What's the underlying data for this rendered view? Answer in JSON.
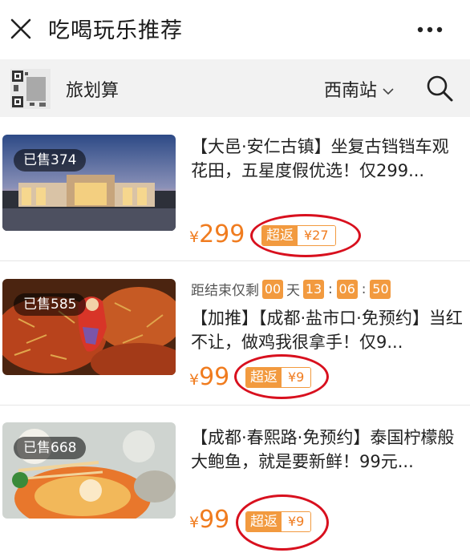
{
  "header": {
    "title": "吃喝玩乐推荐",
    "close_icon": "close-icon",
    "more_icon": "more-dots-icon"
  },
  "shop": {
    "name": "旅划算",
    "city": "西南站",
    "search_icon": "search-icon"
  },
  "colors": {
    "accent": "#f07c1f",
    "badge": "#f29a3f",
    "annotation_circle": "#d8101e"
  },
  "products": [
    {
      "sold": "已售374",
      "title": "【大邑·安仁古镇】坐复古铛铛车观花田，五星度假优选！仅299...",
      "yen": "¥",
      "price": "299",
      "rebate_label": "超返",
      "rebate_amount": "¥27"
    },
    {
      "sold": "已售585",
      "countdown_label": "距结束仅剩",
      "countdown_days": "00",
      "countdown_day_unit": "天",
      "countdown_hours": "13",
      "countdown_minutes": "06",
      "countdown_seconds": "50",
      "title": "【加推】【成都·盐市口·免预约】当红不让，做鸡我很拿手！仅9...",
      "yen": "¥",
      "price": "99",
      "rebate_label": "超返",
      "rebate_amount": "¥9"
    },
    {
      "sold": "已售668",
      "title": "【成都·春熙路·免预约】泰国柠檬般大鲍鱼，就是要新鲜！99元...",
      "yen": "¥",
      "price": "99",
      "rebate_label": "超返",
      "rebate_amount": "¥9"
    }
  ]
}
